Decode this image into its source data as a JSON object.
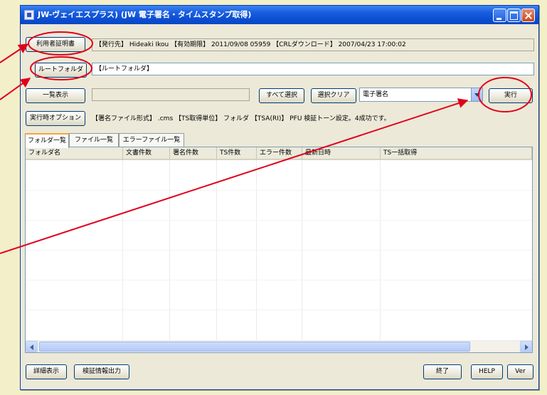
{
  "window": {
    "title": "JW-ヴェイエスプラス) (JW 電子署名・タイムスタンプ取得)"
  },
  "toolbar": {
    "cert_button": "利用者証明書",
    "cert_info": "【発行先】 Hideaki Ikou 【有効期限】 2011/09/08 05959 【CRLダウンロード】 2007/04/23 17:00:02",
    "root_folder_button": "ルートフォルダ",
    "root_folder_value": "【ルートフォルダ】",
    "list_display_button": "一覧表示",
    "path_field_value": "",
    "select_all_button": "すべて選択",
    "clear_selection_button": "選択クリア",
    "mode_select_value": "電子署名",
    "execute_button": "実行",
    "exec_options_button": "実行時オプション",
    "exec_options_info": "【署名ファイル形式】 .cms 【TS取得単位】 フォルダ 【TSA(RI)】 PFU 検証トーン設定。4成功です。"
  },
  "tabs": [
    {
      "label": "フォルダ一覧"
    },
    {
      "label": "ファイル一覧"
    },
    {
      "label": "エラーファイル一覧"
    }
  ],
  "table": {
    "columns": [
      "フォルダ名",
      "文書件数",
      "署名件数",
      "TS件数",
      "エラー件数",
      "最新日時",
      "TS一括取得"
    ]
  },
  "footer": {
    "detail_button": "詳細表示",
    "verify_button": "検証情報出力",
    "exit_button": "終了",
    "help_button": "HELP",
    "ver_button": "Ver"
  },
  "colors": {
    "annotation": "#e0001a",
    "titlebar": "#0b4fd4",
    "page_background": "#f2efc9"
  }
}
